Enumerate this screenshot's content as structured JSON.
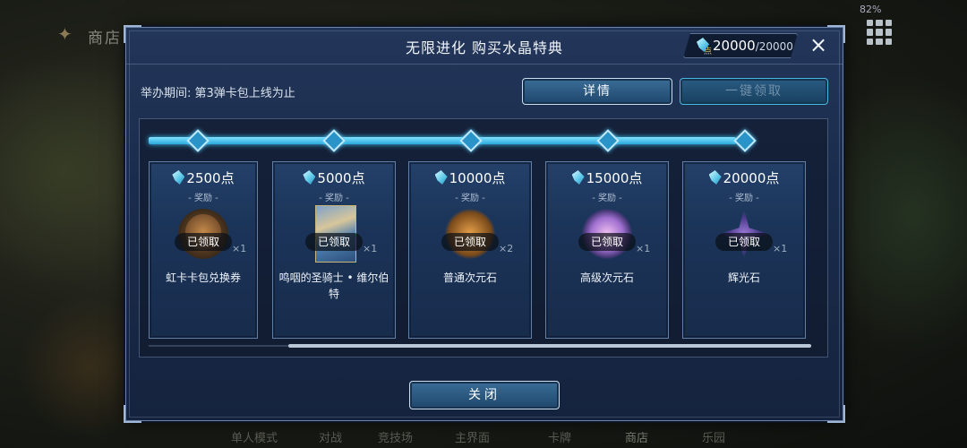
{
  "background": {
    "shop_title": "商店",
    "battery": "82%",
    "nav": [
      "单人模式",
      "对战",
      "竞技场",
      "主界面",
      "卡牌",
      "商店",
      "乐园"
    ]
  },
  "dialog": {
    "title": "无限进化  购买水晶特典",
    "points": {
      "icon": "crystal-icon",
      "suffix": "点",
      "current": "20000",
      "max": "/20000"
    },
    "close_icon": "×",
    "period": "举办期间: 第3弹卡包上线为止",
    "detail_button": "详情",
    "claim_all_button": "一键领取",
    "close_button": "关闭",
    "progress_fraction": 1.0,
    "scroll_fraction": 0.79,
    "rewards": [
      {
        "points": "2500点",
        "reward_label": "- 奖励 -",
        "status": "已领取",
        "qty": "×1",
        "name": "虹卡卡包兑换券",
        "icon": "ticket-icon"
      },
      {
        "points": "5000点",
        "reward_label": "- 奖励 -",
        "status": "已领取",
        "qty": "×1",
        "name": "鸣咽的圣骑士 • 维尔伯特",
        "icon": "card-art-icon"
      },
      {
        "points": "10000点",
        "reward_label": "- 奖励 -",
        "status": "已领取",
        "qty": "×2",
        "name": "普通次元石",
        "icon": "orange-orb-icon"
      },
      {
        "points": "15000点",
        "reward_label": "- 奖励 -",
        "status": "已领取",
        "qty": "×1",
        "name": "高级次元石",
        "icon": "purple-orb-icon"
      },
      {
        "points": "20000点",
        "reward_label": "- 奖励 -",
        "status": "已领取",
        "qty": "×1",
        "name": "辉光石",
        "icon": "star-crystal-icon"
      }
    ]
  }
}
